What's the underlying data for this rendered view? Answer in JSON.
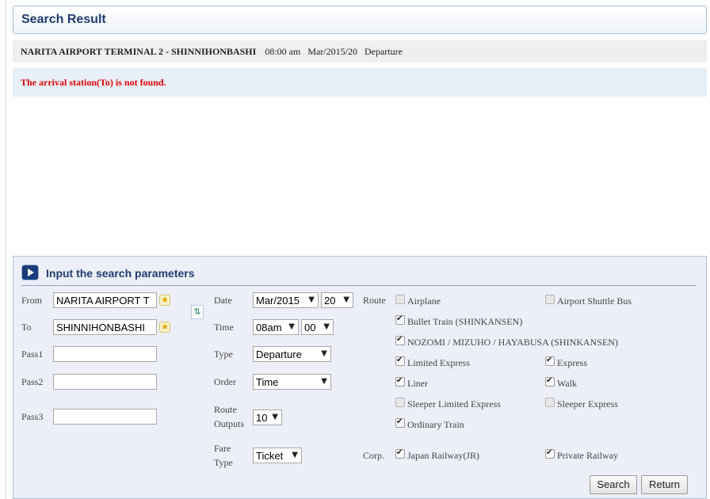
{
  "header": {
    "title": "Search Result"
  },
  "route": {
    "stations": "NARITA AIRPORT TERMINAL 2 - SHINNIHONBASHI",
    "time": "08:00 am",
    "date": "Mar/2015/20",
    "type": "Departure"
  },
  "error": {
    "message": "The arrival station(To) is not found."
  },
  "form": {
    "title": "Input the search parameters",
    "from": {
      "label": "From",
      "value": "NARITA AIRPORT T"
    },
    "to": {
      "label": "To",
      "value": "SHINNIHONBASHI"
    },
    "pass1": {
      "label": "Pass1",
      "value": ""
    },
    "pass2": {
      "label": "Pass2",
      "value": ""
    },
    "pass3": {
      "label": "Pass3",
      "value": ""
    },
    "date": {
      "label": "Date",
      "month": "Mar/2015",
      "day": "20"
    },
    "time": {
      "label": "Time",
      "hour": "08am",
      "minute": "00"
    },
    "type": {
      "label": "Type",
      "value": "Departure"
    },
    "order": {
      "label": "Order",
      "value": "Time"
    },
    "route_outputs": {
      "label1": "Route",
      "label2": "Outputs",
      "value": "10"
    },
    "fare_type": {
      "label1": "Fare",
      "label2": "Type",
      "value": "Ticket"
    },
    "route_label": "Route",
    "corp_label": "Corp.",
    "route_options": [
      {
        "label": "Airplane",
        "checked": false
      },
      {
        "label": "Airport Shuttle Bus",
        "checked": false
      },
      {
        "label": "Bullet Train (SHINKANSEN)",
        "checked": true
      },
      {
        "label": "NOZOMI / MIZUHO / HAYABUSA (SHINKANSEN)",
        "checked": true
      },
      {
        "label": "Limited Express",
        "checked": true
      },
      {
        "label": "Express",
        "checked": true
      },
      {
        "label": "Liner",
        "checked": true
      },
      {
        "label": "Walk",
        "checked": true
      },
      {
        "label": "Sleeper Limited Express",
        "checked": false
      },
      {
        "label": "Sleeper Express",
        "checked": false
      },
      {
        "label": "Ordinary Train",
        "checked": true
      }
    ],
    "corp_options": [
      {
        "label": "Japan Railway(JR)",
        "checked": true
      },
      {
        "label": "Private Railway",
        "checked": true
      }
    ],
    "search_label": "Search",
    "return_label": "Return"
  }
}
